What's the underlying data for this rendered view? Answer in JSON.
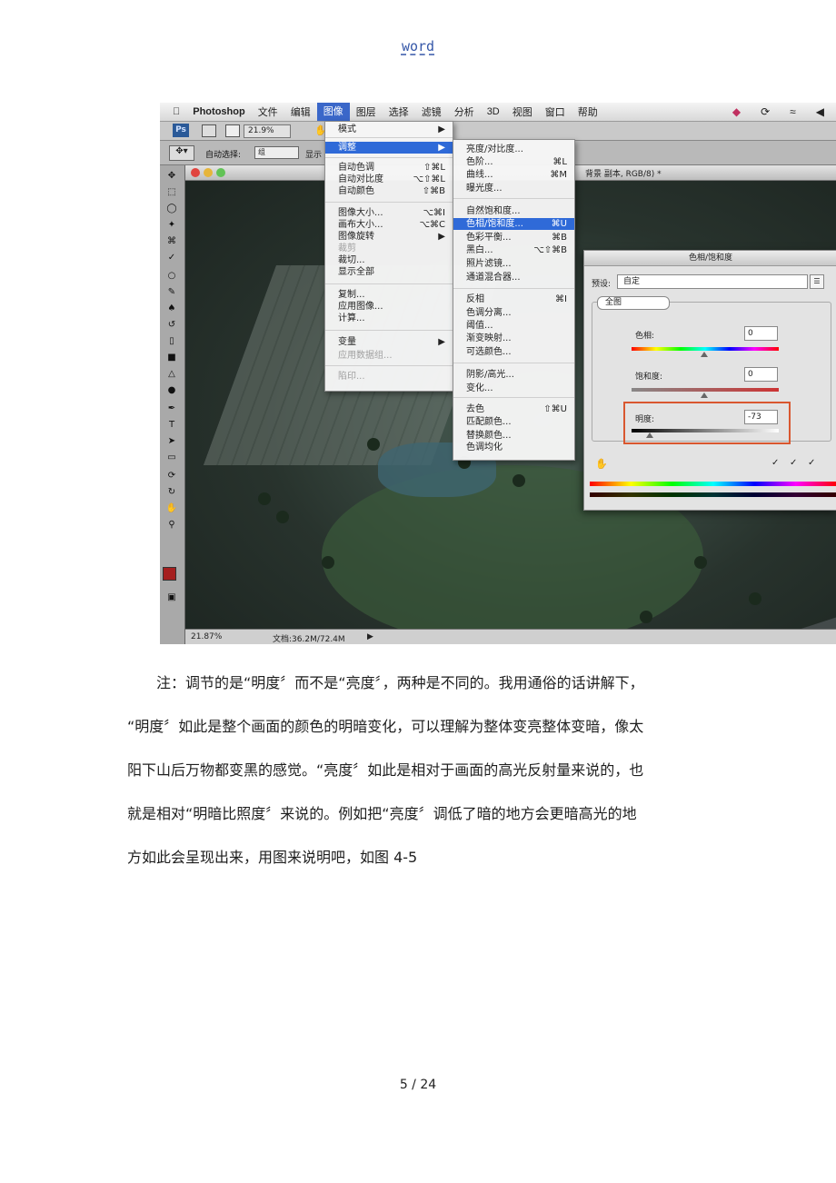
{
  "header": {
    "label": "word"
  },
  "screenshot": {
    "menubar": {
      "apple": "",
      "app": "Photoshop",
      "items": [
        "文件",
        "编辑",
        "图像",
        "图层",
        "选择",
        "滤镜",
        "分析",
        "3D",
        "视图",
        "窗口",
        "帮助"
      ],
      "active_item": "图像"
    },
    "options": {
      "ps_logo": "Ps",
      "zoom": "21.9%",
      "auto_select_label": "自动选择:",
      "auto_select_value": "组",
      "show_label": "显示"
    },
    "doc_title": "背景 副本, RGB/8) *",
    "status": {
      "zoom": "21.87%",
      "doc_size": "文档:36.2M/72.4M"
    },
    "image_menu": {
      "items": [
        {
          "label": "模式",
          "shortcut": "▶"
        },
        {
          "label": "调整",
          "shortcut": "▶",
          "highlight": true
        },
        {
          "label": "自动色调",
          "shortcut": "⇧⌘L"
        },
        {
          "label": "自动对比度",
          "shortcut": "⌥⇧⌘L"
        },
        {
          "label": "自动颜色",
          "shortcut": "⇧⌘B"
        },
        {
          "label": "图像大小...",
          "shortcut": "⌥⌘I"
        },
        {
          "label": "画布大小...",
          "shortcut": "⌥⌘C"
        },
        {
          "label": "图像旋转",
          "shortcut": "▶"
        },
        {
          "label": "裁剪",
          "shortcut": "",
          "disabled": true
        },
        {
          "label": "裁切...",
          "shortcut": ""
        },
        {
          "label": "显示全部",
          "shortcut": ""
        },
        {
          "label": "复制...",
          "shortcut": ""
        },
        {
          "label": "应用图像...",
          "shortcut": ""
        },
        {
          "label": "计算...",
          "shortcut": ""
        },
        {
          "label": "变量",
          "shortcut": "▶"
        },
        {
          "label": "应用数据组...",
          "shortcut": "",
          "disabled": true
        },
        {
          "label": "陷印...",
          "shortcut": "",
          "disabled": true
        }
      ]
    },
    "adjust_menu": {
      "items": [
        {
          "label": "亮度/对比度...",
          "shortcut": ""
        },
        {
          "label": "色阶...",
          "shortcut": "⌘L"
        },
        {
          "label": "曲线...",
          "shortcut": "⌘M"
        },
        {
          "label": "曝光度...",
          "shortcut": ""
        },
        {
          "label": "自然饱和度...",
          "shortcut": ""
        },
        {
          "label": "色相/饱和度...",
          "shortcut": "⌘U",
          "highlight": true
        },
        {
          "label": "色彩平衡...",
          "shortcut": "⌘B"
        },
        {
          "label": "黑白...",
          "shortcut": "⌥⇧⌘B"
        },
        {
          "label": "照片滤镜...",
          "shortcut": ""
        },
        {
          "label": "通道混合器...",
          "shortcut": ""
        },
        {
          "label": "反相",
          "shortcut": "⌘I"
        },
        {
          "label": "色调分离...",
          "shortcut": ""
        },
        {
          "label": "阈值...",
          "shortcut": ""
        },
        {
          "label": "渐变映射...",
          "shortcut": ""
        },
        {
          "label": "可选颜色...",
          "shortcut": ""
        },
        {
          "label": "阴影/高光...",
          "shortcut": ""
        },
        {
          "label": "变化...",
          "shortcut": ""
        },
        {
          "label": "去色",
          "shortcut": "⇧⌘U"
        },
        {
          "label": "匹配颜色...",
          "shortcut": ""
        },
        {
          "label": "替换颜色...",
          "shortcut": ""
        },
        {
          "label": "色调均化",
          "shortcut": ""
        }
      ]
    },
    "hue_dialog": {
      "title": "色相/饱和度",
      "preset_label": "预设:",
      "preset_value": "自定",
      "channel": "全图",
      "hue_label": "色相:",
      "hue_value": "0",
      "sat_label": "饱和度:",
      "sat_value": "0",
      "light_label": "明度:",
      "light_value": "-73",
      "accent_color": "#d9572f"
    }
  },
  "body_lines": [
    "注：调节的是“明度〞而不是“亮度〞，两种是不同的。我用通俗的话讲解下，",
    "“明度〞如此是整个画面的颜色的明暗变化，可以理解为整体变亮整体变暗，像太",
    "阳下山后万物都变黑的感觉。“亮度〞如此是相对于画面的高光反射量来说的，也",
    "就是相对“明暗比照度〞来说的。例如把“亮度〞调低了暗的地方会更暗高光的地",
    "方如此会呈现出来，用图来说明吧，如图 4-5"
  ],
  "footer": {
    "page": "5 / 24"
  }
}
